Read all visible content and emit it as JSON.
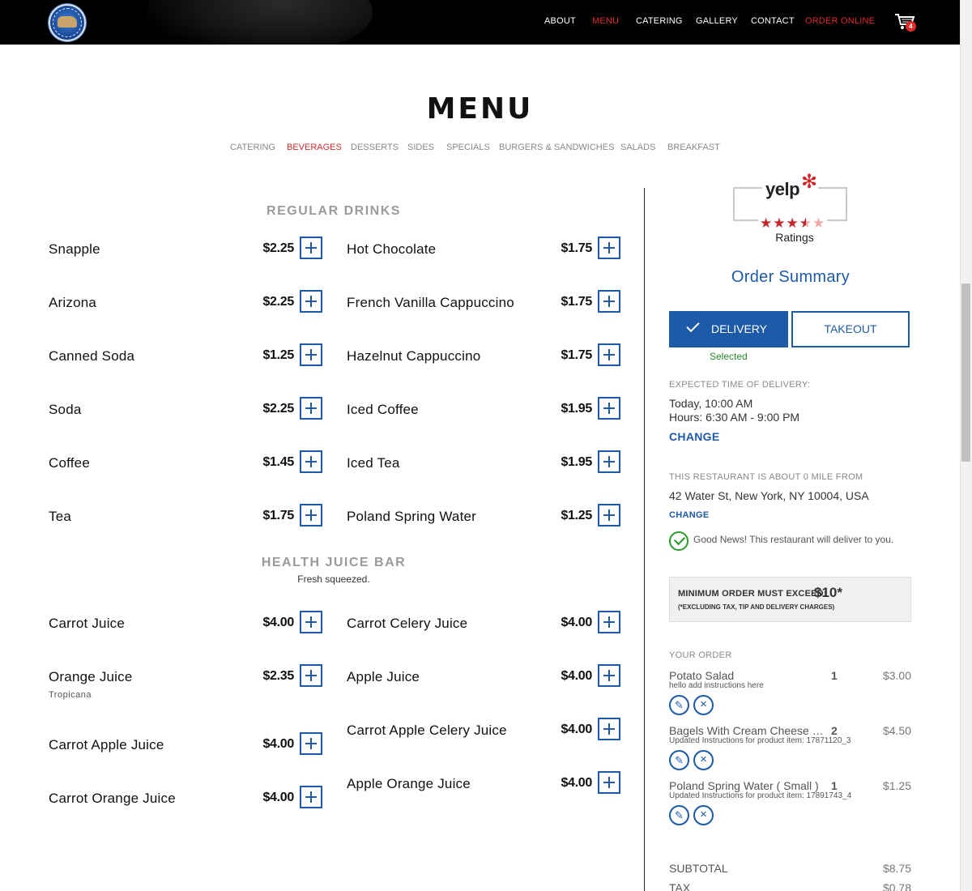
{
  "nav": {
    "items": [
      "ABOUT",
      "MENU",
      "CATERING",
      "GALLERY",
      "CONTACT",
      "ORDER ONLINE"
    ],
    "active": "MENU",
    "cart_count": "4"
  },
  "page": {
    "title": "MENU",
    "categories": [
      "CATERING",
      "BEVERAGES",
      "DESSERTS",
      "SIDES",
      "SPECIALS",
      "BURGERS & SANDWICHES",
      "SALADS",
      "BREAKFAST"
    ],
    "active_category": "BEVERAGES"
  },
  "sections": {
    "regular": {
      "title": "REGULAR DRINKS",
      "items": [
        {
          "name": "Snapple",
          "price": "$2.25"
        },
        {
          "name": "Hot Chocolate",
          "price": "$1.75"
        },
        {
          "name": "Arizona",
          "price": "$2.25"
        },
        {
          "name": "French Vanilla Cappuccino",
          "price": "$1.75"
        },
        {
          "name": "Canned Soda",
          "price": "$1.25"
        },
        {
          "name": "Hazelnut Cappuccino",
          "price": "$1.75"
        },
        {
          "name": "Soda",
          "price": "$2.25"
        },
        {
          "name": "Iced Coffee",
          "price": "$1.95"
        },
        {
          "name": "Coffee",
          "price": "$1.45"
        },
        {
          "name": "Iced Tea",
          "price": "$1.95"
        },
        {
          "name": "Tea",
          "price": "$1.75"
        },
        {
          "name": "Poland Spring Water",
          "price": "$1.25"
        }
      ]
    },
    "juice": {
      "title": "HEALTH JUICE BAR",
      "subtitle": "Fresh squeezed.",
      "items": [
        {
          "name": "Carrot Juice",
          "price": "$4.00"
        },
        {
          "name": "Carrot Celery Juice",
          "price": "$4.00"
        },
        {
          "name": "Orange Juice",
          "price": "$2.35",
          "note": "Tropicana"
        },
        {
          "name": "Apple Juice",
          "price": "$4.00"
        },
        {
          "name": "Carrot Apple Celery Juice",
          "price": "$4.00"
        },
        {
          "name": "Carrot Apple Juice",
          "price": "$4.00"
        },
        {
          "name": "Apple Orange Juice",
          "price": "$4.00"
        },
        {
          "name": "Carrot Orange Juice",
          "price": "$4.00"
        }
      ]
    }
  },
  "sidebar": {
    "yelp": {
      "word": "yelp",
      "rating": 3.5,
      "caption": "Ratings"
    },
    "order_summary": "Order Summary",
    "delivery_label": "DELIVERY",
    "takeout_label": "TAKEOUT",
    "selected_note": "Selected",
    "expected_label": "EXPECTED TIME OF DELIVERY:",
    "expected_time": "Today, 10:00 AM",
    "hours": "Hours: 6:30 AM - 9:00 PM",
    "change_label": "CHANGE",
    "distance_label": "THIS RESTAURANT IS ABOUT 0 MILE FROM",
    "address": "42 Water St, New York, NY 10004, USA",
    "good_news": "Good News! This restaurant will deliver to you.",
    "min_order_label": "MINIMUM ORDER MUST EXCEED:",
    "min_order_amount": "$10*",
    "min_order_note": "(*EXCLUDING TAX, TIP AND DELIVERY CHARGES)",
    "your_order_label": "YOUR ORDER",
    "order_items": [
      {
        "name": "Potato Salad",
        "qty": "1",
        "price": "$3.00",
        "instructions": "hello add instructions here"
      },
      {
        "name": "Bagels With Cream Cheese ( Regular )",
        "qty": "2",
        "price": "$4.50",
        "instructions": "Updated Instructions for product item: 17871120_3"
      },
      {
        "name": "Poland Spring Water ( Small )",
        "qty": "1",
        "price": "$1.25",
        "instructions": "Updated Instructions for product item: 17891743_4"
      }
    ],
    "subtotal_label": "SUBTOTAL",
    "subtotal": "$8.75",
    "tax_label": "TAX",
    "tax": "$0.78"
  },
  "colors": {
    "accent": "#1d5aa8",
    "active": "#e02b2b",
    "good": "#2a9a2a"
  }
}
